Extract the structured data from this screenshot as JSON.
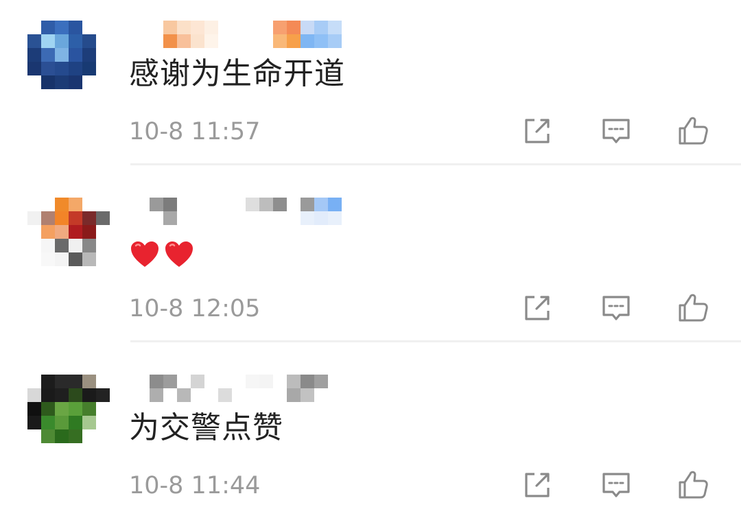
{
  "comments": [
    {
      "text": "感谢为生命开道",
      "timestamp": "10-8 11:57",
      "avatar_colors": [
        "#ffffff",
        "#2f5da8",
        "#3b6fbe",
        "#2a55a0",
        "#ffffff",
        "#ffffff",
        "#2a5294",
        "#9fd4f2",
        "#6aa7dc",
        "#2d5fa8",
        "#254b8c",
        "#ffffff",
        "#1c3c78",
        "#3c6ab4",
        "#7fb4e4",
        "#2a54a0",
        "#1d3d7a",
        "#ffffff",
        "#1a3670",
        "#2b4f94",
        "#254a8e",
        "#1f4283",
        "#183a73",
        "#ffffff",
        "#ffffff",
        "#17336a",
        "#1c3b75",
        "#1a3570",
        "#ffffff",
        "#ffffff"
      ],
      "name_colors": [
        "#ffffff",
        "#ffffff",
        "#f8c8a0",
        "#fbe0c8",
        "#fde6d4",
        "#fdf0e4",
        "#ffffff",
        "#ffffff",
        "#ffffff",
        "#ffffff",
        "#f7a070",
        "#f48a56",
        "#c8daf6",
        "#a8ccf6",
        "#c6ddf8",
        "#ffffff",
        "#ffffff",
        "#f2914a",
        "#f8c09a",
        "#fbe3ce",
        "#fef4ea",
        "#ffffff",
        "#ffffff",
        "#ffffff",
        "#ffffff",
        "#f9b878",
        "#f7a04a",
        "#7fb6f3",
        "#8fc0f6",
        "#a7ccf6"
      ]
    },
    {
      "text": "",
      "timestamp": "10-8 12:05",
      "avatar_colors": [
        "#ffffff",
        "#ffffff",
        "#f08a2a",
        "#f4a868",
        "#ffffff",
        "#ffffff",
        "#f1f1f1",
        "#b08070",
        "#f28428",
        "#c43a28",
        "#7a2a2a",
        "#6a6a6a",
        "#ffffff",
        "#f4a060",
        "#f0aa80",
        "#b01c20",
        "#8a1a1a",
        "#ffffff",
        "#ffffff",
        "#f6f6f6",
        "#6a6a6a",
        "#f0f0f0",
        "#888888",
        "#ffffff",
        "#ffffff",
        "#f8f8f8",
        "#f4f4f4",
        "#5a5a5a",
        "#b8b8b8",
        "#ffffff"
      ],
      "name_colors": [
        "#ffffff",
        "#9a9a9a",
        "#7c7c7c",
        "#ffffff",
        "#ffffff",
        "#ffffff",
        "#ffffff",
        "#ffffff",
        "#dedede",
        "#bdbdbd",
        "#8e8e8e",
        "#ffffff",
        "#9a9a9a",
        "#a4c8f6",
        "#78b0f4",
        "#ffffff",
        "#ffffff",
        "#a8a8a8",
        "#ffffff",
        "#ffffff",
        "#ffffff",
        "#ffffff",
        "#ffffff",
        "#ffffff",
        "#ffffff",
        "#ffffff",
        "#ffffff",
        "#e8f0fb",
        "#e2ecfb",
        "#e8f0fb"
      ],
      "heart_color": "#e8232f"
    },
    {
      "text": "为交警点赞",
      "timestamp": "10-8 11:44",
      "avatar_colors": [
        "#ffffff",
        "#1c1c1c",
        "#2a2a2a",
        "#2a2a2a",
        "#9a9080",
        "#ffffff",
        "#d8d8d8",
        "#1a1a1a",
        "#1f1f1f",
        "#2c4a1c",
        "#1a1a1a",
        "#222222",
        "#101010",
        "#2e5a1c",
        "#6aa644",
        "#5aa03a",
        "#467e2c",
        "#ffffff",
        "#1a1a1a",
        "#3a8a2c",
        "#5a9a3a",
        "#2f7a22",
        "#a6c890",
        "#ffffff",
        "#ffffff",
        "#4e8a34",
        "#2a6a1c",
        "#366e22",
        "#ffffff",
        "#ffffff"
      ],
      "name_colors": [
        "#ffffff",
        "#8c8c8c",
        "#9c9c9c",
        "#ffffff",
        "#d4d4d4",
        "#ffffff",
        "#ffffff",
        "#ffffff",
        "#f6f6f6",
        "#f4f4f4",
        "#ffffff",
        "#bcbcbc",
        "#8a8a8a",
        "#a0a0a0",
        "#ffffff",
        "#ffffff",
        "#aeaeae",
        "#ffffff",
        "#b8b8b8",
        "#ffffff",
        "#ffffff",
        "#dcdcdc",
        "#ffffff",
        "#ffffff",
        "#ffffff",
        "#ffffff",
        "#a8a8a8",
        "#c2c2c2",
        "#ffffff",
        "#ffffff"
      ]
    }
  ],
  "icons": {
    "share": "share-icon",
    "reply": "comment-icon",
    "like": "thumbs-up-icon",
    "heart": "red-heart-icon"
  },
  "colors": {
    "text": "#222222",
    "timestamp": "#9a9a9a",
    "icon": "#8a8a8a",
    "divider": "#f0f0f0"
  }
}
